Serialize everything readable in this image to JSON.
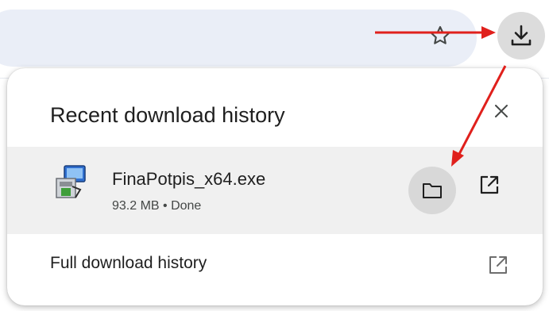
{
  "toolbar": {
    "star_icon": "star-outline-icon",
    "download_icon": "download-icon"
  },
  "bubble": {
    "title": "Recent download history",
    "close_icon": "close-icon",
    "item": {
      "file_name": "FinaPotpis_x64.exe",
      "status": "93.2 MB • Done",
      "file_icon": "installer-icon",
      "folder_icon": "folder-icon",
      "open_icon": "open-external-icon"
    },
    "full_history_label": "Full download history",
    "full_history_icon": "open-external-icon"
  },
  "colors": {
    "omnibox_bg": "#eaeef7",
    "row_bg": "#f0f0f0",
    "button_hover": "#d8d8d8",
    "annotation_arrow": "#e0201c",
    "text_primary": "#1f1f1f",
    "text_secondary": "#444746"
  }
}
